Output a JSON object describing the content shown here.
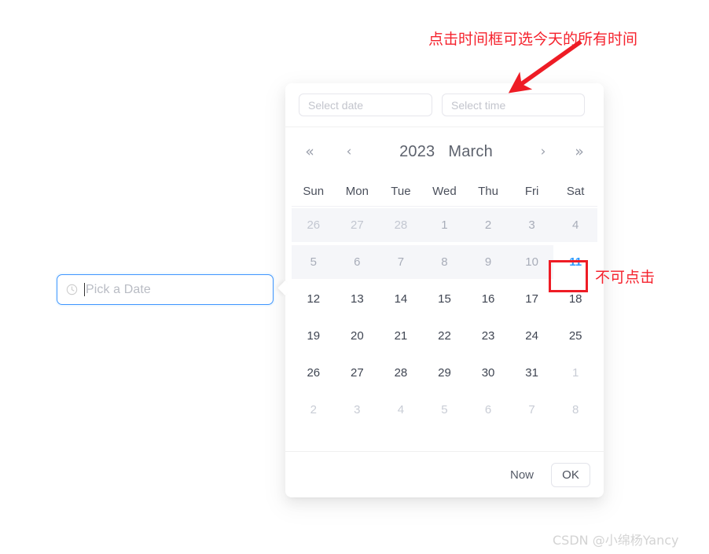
{
  "trigger": {
    "icon": "clock-icon",
    "placeholder": "Pick a Date",
    "value": "",
    "focused": true,
    "border_color": "#4096ff"
  },
  "panel": {
    "inputs": {
      "date": {
        "placeholder": "Select date",
        "value": ""
      },
      "time": {
        "placeholder": "Select time",
        "value": ""
      }
    },
    "header": {
      "super_prev_label": "«",
      "prev_label": "‹",
      "year": "2023",
      "month": "March",
      "next_label": "›",
      "super_next_label": "»"
    },
    "weekdays": [
      "Sun",
      "Mon",
      "Tue",
      "Wed",
      "Thu",
      "Fri",
      "Sat"
    ],
    "weeks": [
      {
        "disabled": true,
        "days": [
          {
            "label": "26",
            "out_month": true
          },
          {
            "label": "27",
            "out_month": true
          },
          {
            "label": "28",
            "out_month": true
          },
          {
            "label": "1",
            "out_month": false
          },
          {
            "label": "2",
            "out_month": false
          },
          {
            "label": "3",
            "out_month": false
          },
          {
            "label": "4",
            "out_month": false
          }
        ]
      },
      {
        "disabled": true,
        "days": [
          {
            "label": "5",
            "out_month": false
          },
          {
            "label": "6",
            "out_month": false
          },
          {
            "label": "7",
            "out_month": false
          },
          {
            "label": "8",
            "out_month": false
          },
          {
            "label": "9",
            "out_month": false
          },
          {
            "label": "10",
            "out_month": false
          },
          {
            "label": "11",
            "out_month": false,
            "today": true
          }
        ]
      },
      {
        "disabled": false,
        "days": [
          {
            "label": "12",
            "out_month": false
          },
          {
            "label": "13",
            "out_month": false
          },
          {
            "label": "14",
            "out_month": false
          },
          {
            "label": "15",
            "out_month": false
          },
          {
            "label": "16",
            "out_month": false
          },
          {
            "label": "17",
            "out_month": false
          },
          {
            "label": "18",
            "out_month": false
          }
        ]
      },
      {
        "disabled": false,
        "days": [
          {
            "label": "19",
            "out_month": false
          },
          {
            "label": "20",
            "out_month": false
          },
          {
            "label": "21",
            "out_month": false
          },
          {
            "label": "22",
            "out_month": false
          },
          {
            "label": "23",
            "out_month": false
          },
          {
            "label": "24",
            "out_month": false
          },
          {
            "label": "25",
            "out_month": false
          }
        ]
      },
      {
        "disabled": false,
        "days": [
          {
            "label": "26",
            "out_month": false
          },
          {
            "label": "27",
            "out_month": false
          },
          {
            "label": "28",
            "out_month": false
          },
          {
            "label": "29",
            "out_month": false
          },
          {
            "label": "30",
            "out_month": false
          },
          {
            "label": "31",
            "out_month": false
          },
          {
            "label": "1",
            "out_month": true
          }
        ]
      },
      {
        "disabled": false,
        "days": [
          {
            "label": "2",
            "out_month": true
          },
          {
            "label": "3",
            "out_month": true
          },
          {
            "label": "4",
            "out_month": true
          },
          {
            "label": "5",
            "out_month": true
          },
          {
            "label": "6",
            "out_month": true
          },
          {
            "label": "7",
            "out_month": true
          },
          {
            "label": "8",
            "out_month": true
          }
        ]
      }
    ],
    "footer": {
      "now_label": "Now",
      "ok_label": "OK"
    }
  },
  "annotations": {
    "time_hint": "点击时间框可选今天的所有时间",
    "not_clickable": "不可点击",
    "color": "#f5222d",
    "highlight_box_color": "#ee1c25"
  },
  "watermark": "CSDN @小绵杨Yancy"
}
